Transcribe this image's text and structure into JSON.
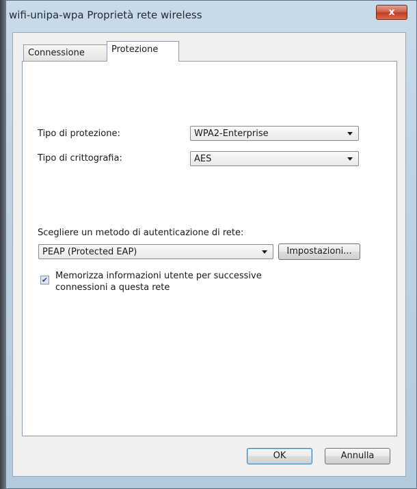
{
  "window": {
    "title": "wifi-unipa-wpa Proprietà rete wireless",
    "close_glyph": "x"
  },
  "tabs": [
    {
      "label": "Connessione",
      "active": false
    },
    {
      "label": "Protezione",
      "active": true
    }
  ],
  "security": {
    "type_label": "Tipo di protezione:",
    "type_value": "WPA2-Enterprise",
    "encryption_label": "Tipo di crittografia:",
    "encryption_value": "AES",
    "auth_method_label": "Scegliere un metodo di autenticazione di rete:",
    "auth_method_value": "PEAP (Protected EAP)",
    "settings_button": "Impostazioni...",
    "remember_checkbox_label_line1": "Memorizza informazioni utente per successive",
    "remember_checkbox_label_line2": "connessioni a questa rete",
    "remember_checked": true
  },
  "footer": {
    "ok_label": "OK",
    "cancel_label": "Annulla"
  },
  "icons": {
    "close": "close-icon",
    "dropdown": "chevron-down-icon",
    "check": "checkmark-icon"
  }
}
